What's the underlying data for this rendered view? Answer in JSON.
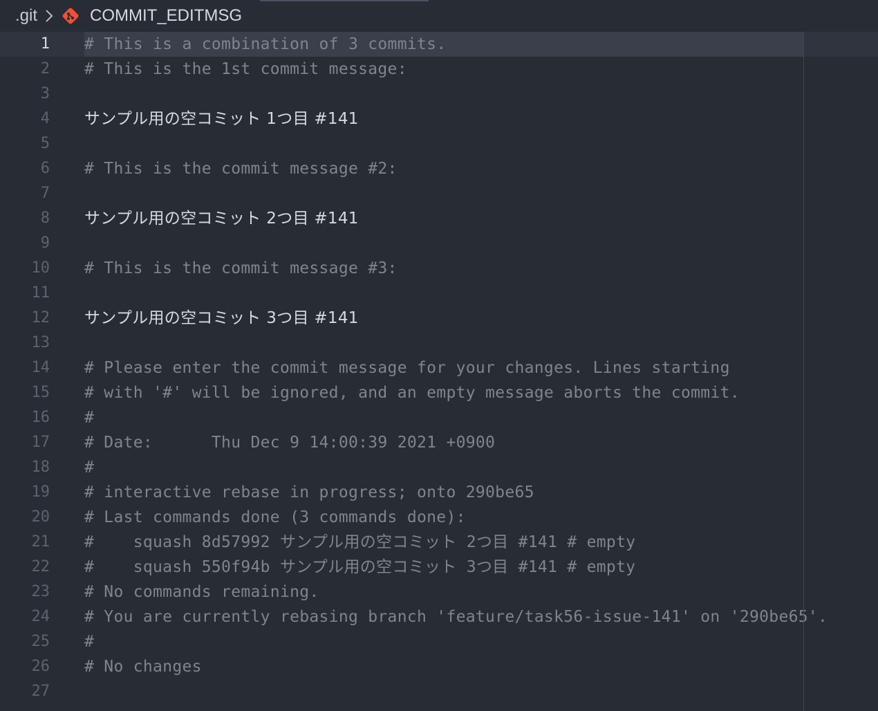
{
  "breadcrumb": {
    "folder": ".git",
    "file": "COMMIT_EDITMSG",
    "file_icon": "git-icon",
    "separator_icon": "chevron-right-icon",
    "icon_color": "#f05033"
  },
  "editor": {
    "current_line": 1,
    "lines": [
      {
        "num": "1",
        "text": "# This is a combination of 3 commits.",
        "kind": "comment"
      },
      {
        "num": "2",
        "text": "# This is the 1st commit message:",
        "kind": "comment"
      },
      {
        "num": "3",
        "text": "",
        "kind": "blank"
      },
      {
        "num": "4",
        "text": "サンプル用の空コミット 1つ目 #141",
        "kind": "message"
      },
      {
        "num": "5",
        "text": "",
        "kind": "blank"
      },
      {
        "num": "6",
        "text": "# This is the commit message #2:",
        "kind": "comment"
      },
      {
        "num": "7",
        "text": "",
        "kind": "blank"
      },
      {
        "num": "8",
        "text": "サンプル用の空コミット 2つ目 #141",
        "kind": "message"
      },
      {
        "num": "9",
        "text": "",
        "kind": "blank"
      },
      {
        "num": "10",
        "text": "# This is the commit message #3:",
        "kind": "comment"
      },
      {
        "num": "11",
        "text": "",
        "kind": "blank"
      },
      {
        "num": "12",
        "text": "サンプル用の空コミット 3つ目 #141",
        "kind": "message"
      },
      {
        "num": "13",
        "text": "",
        "kind": "blank"
      },
      {
        "num": "14",
        "text": "# Please enter the commit message for your changes. Lines starting",
        "kind": "comment"
      },
      {
        "num": "15",
        "text": "# with '#' will be ignored, and an empty message aborts the commit.",
        "kind": "comment"
      },
      {
        "num": "16",
        "text": "#",
        "kind": "comment"
      },
      {
        "num": "17",
        "text": "# Date:      Thu Dec 9 14:00:39 2021 +0900",
        "kind": "comment"
      },
      {
        "num": "18",
        "text": "#",
        "kind": "comment"
      },
      {
        "num": "19",
        "text": "# interactive rebase in progress; onto 290be65",
        "kind": "comment"
      },
      {
        "num": "20",
        "text": "# Last commands done (3 commands done):",
        "kind": "comment"
      },
      {
        "num": "21",
        "text": "#    squash 8d57992 サンプル用の空コミット 2つ目 #141 # empty",
        "kind": "comment"
      },
      {
        "num": "22",
        "text": "#    squash 550f94b サンプル用の空コミット 3つ目 #141 # empty",
        "kind": "comment"
      },
      {
        "num": "23",
        "text": "# No commands remaining.",
        "kind": "comment"
      },
      {
        "num": "24",
        "text": "# You are currently rebasing branch 'feature/task56-issue-141' on '290be65'.",
        "kind": "comment"
      },
      {
        "num": "25",
        "text": "#",
        "kind": "comment"
      },
      {
        "num": "26",
        "text": "# No changes",
        "kind": "comment"
      },
      {
        "num": "27",
        "text": "",
        "kind": "blank"
      }
    ]
  },
  "colors": {
    "background": "#282c34",
    "comment": "#7f848e",
    "message": "#d7dae0",
    "line_number": "#5c6370",
    "line_number_active": "#d7dae0",
    "current_line_highlight": "#3a3f4b"
  }
}
